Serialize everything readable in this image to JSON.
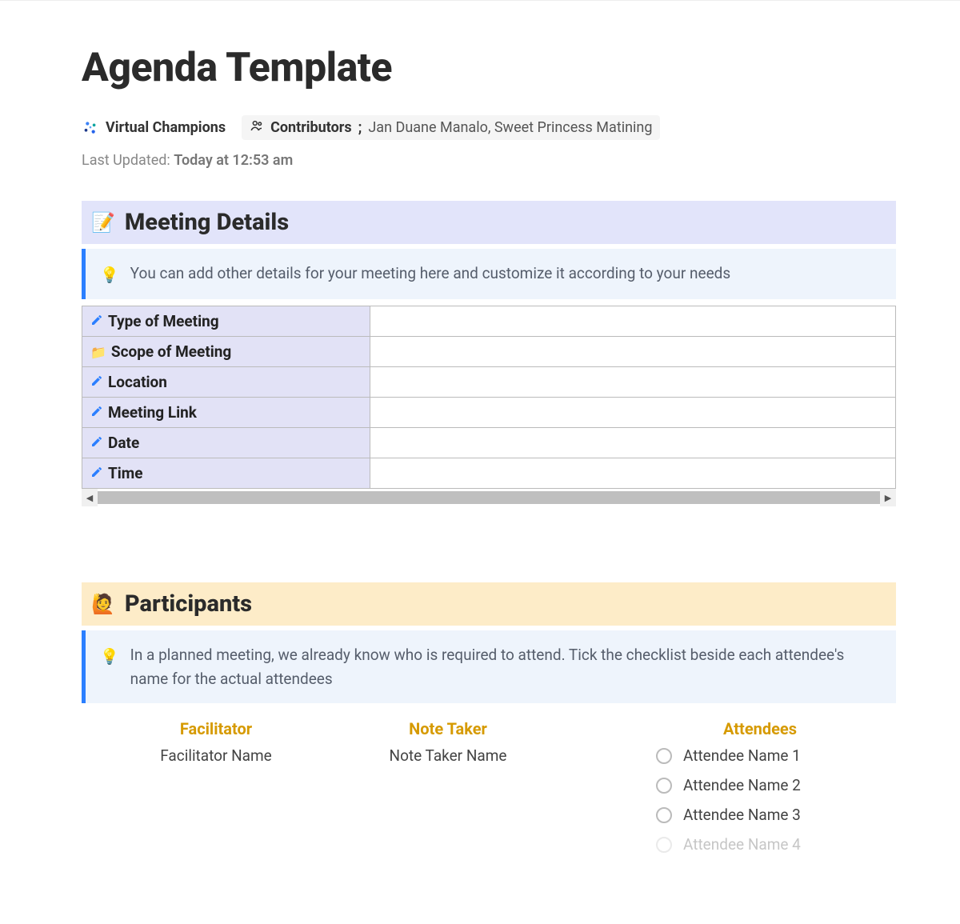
{
  "title": "Agenda Template",
  "team": "Virtual Champions",
  "contributors_label": "Contributors",
  "contributors_separator": ";",
  "contributors_names": "Jan Duane Manalo, Sweet Princess Matining",
  "last_updated_label": "Last Updated:",
  "last_updated_value": "Today at 12:53 am",
  "sections": {
    "details": {
      "title": "Meeting Details",
      "callout": "You can add other details for your meeting here and customize it according to your needs",
      "rows": [
        {
          "icon": "pencil",
          "label": "Type of Meeting",
          "value": ""
        },
        {
          "icon": "folder",
          "label": "Scope of Meeting",
          "value": ""
        },
        {
          "icon": "pencil",
          "label": "Location",
          "value": ""
        },
        {
          "icon": "pencil",
          "label": "Meeting Link",
          "value": ""
        },
        {
          "icon": "pencil",
          "label": "Date",
          "value": ""
        },
        {
          "icon": "pencil",
          "label": "Time",
          "value": ""
        }
      ]
    },
    "participants": {
      "title": "Participants",
      "callout": "In a planned meeting, we already know who is required to attend. Tick the checklist beside each attendee's name for the actual attendees",
      "facilitator_header": "Facilitator",
      "facilitator_value": "Facilitator Name",
      "notetaker_header": "Note Taker",
      "notetaker_value": "Note Taker Name",
      "attendees_header": "Attendees",
      "attendees": [
        {
          "name": "Attendee Name 1",
          "checked": false
        },
        {
          "name": "Attendee Name 2",
          "checked": false
        },
        {
          "name": "Attendee Name 3",
          "checked": false
        },
        {
          "name": "Attendee Name 4",
          "checked": false
        }
      ]
    }
  }
}
